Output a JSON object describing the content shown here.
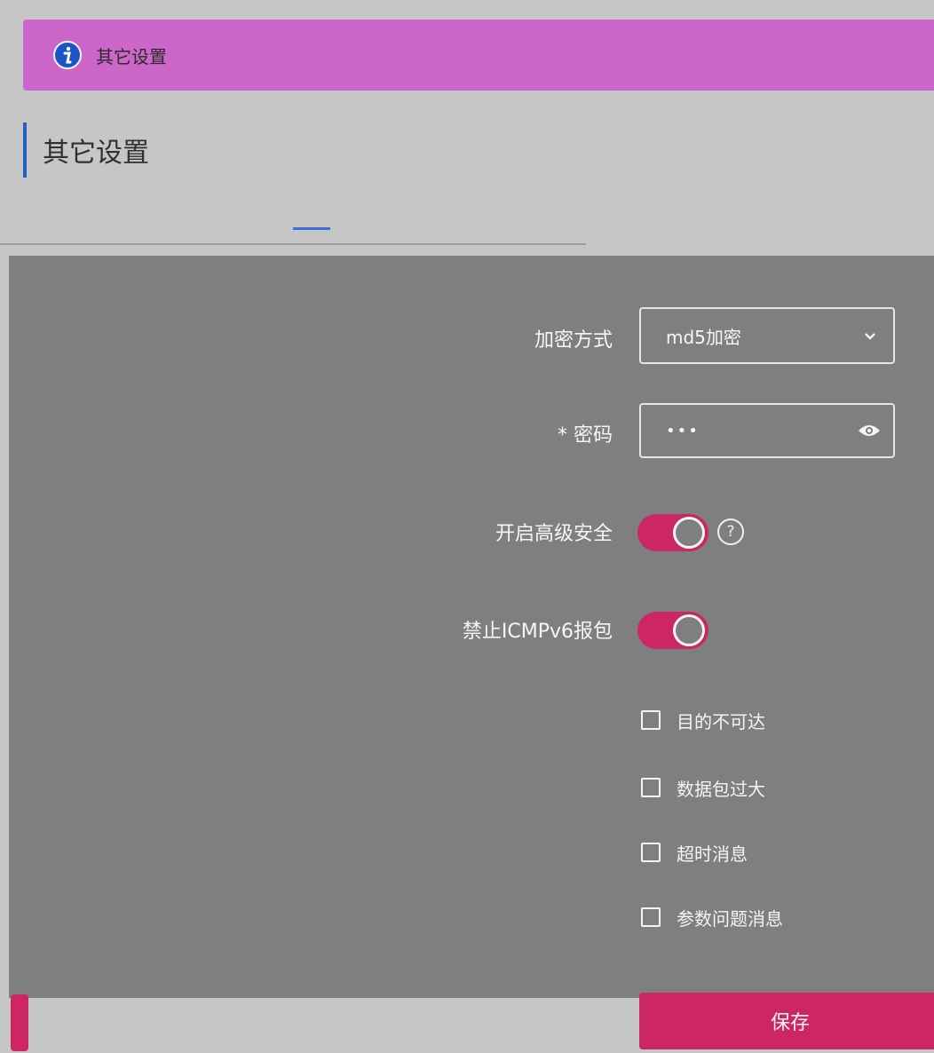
{
  "banner": {
    "text": "其它设置",
    "icon": "info-icon",
    "color": "#cc66c8"
  },
  "section": {
    "title": "其它设置",
    "accent": "#1f62c9"
  },
  "form": {
    "encryption": {
      "label": "加密方式",
      "value": "md5加密"
    },
    "password": {
      "label": "密码",
      "value": "•••"
    },
    "advanced_security": {
      "label": "开启高级安全",
      "enabled": true
    },
    "block_icmpv6": {
      "label": "禁止ICMPv6报包",
      "enabled": true
    },
    "options": [
      {
        "label": "目的不可达",
        "checked": false
      },
      {
        "label": "数据包过大",
        "checked": false
      },
      {
        "label": "超时消息",
        "checked": false
      },
      {
        "label": "参数问题消息",
        "checked": false
      }
    ]
  },
  "actions": {
    "save_label": "保存",
    "accent": "#cc2664"
  }
}
